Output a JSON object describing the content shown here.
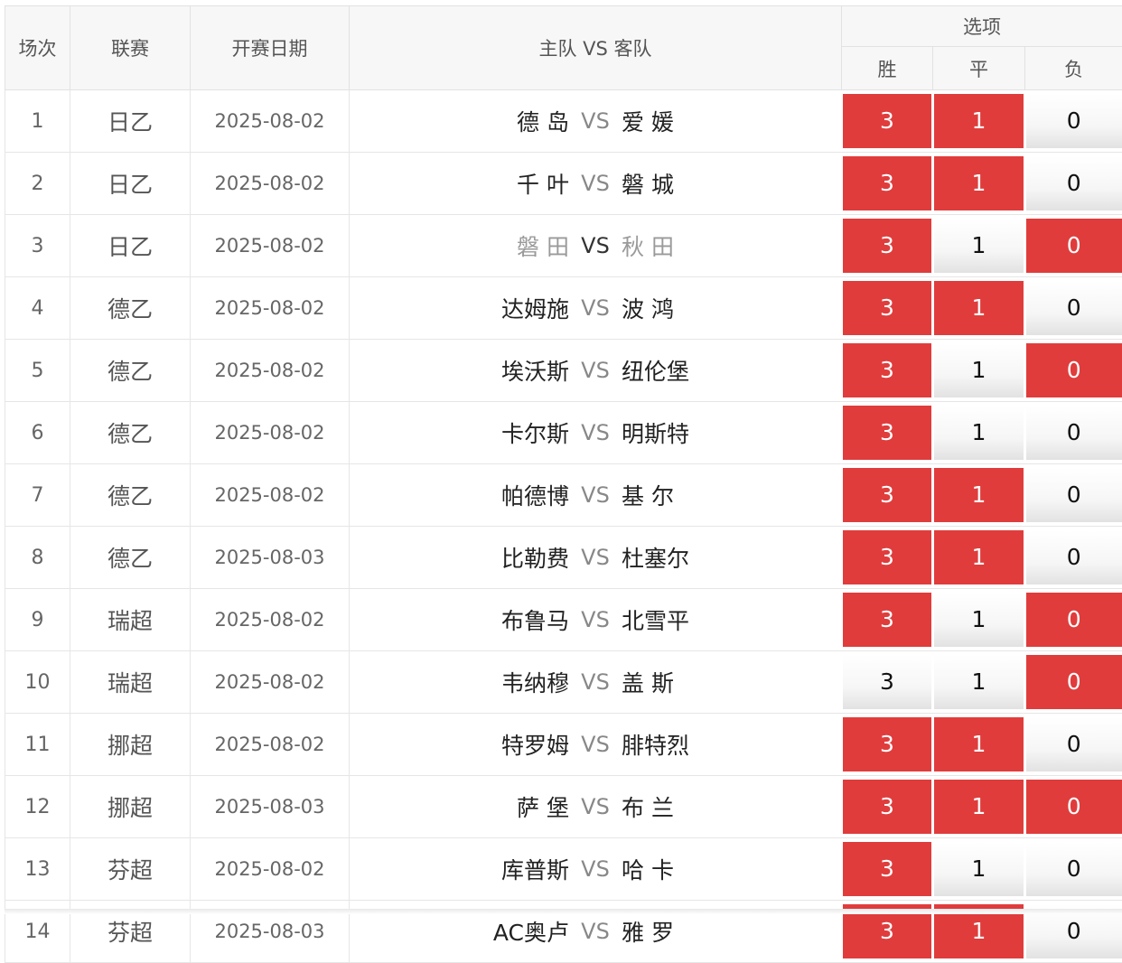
{
  "headers": {
    "no": "场次",
    "league": "联赛",
    "date": "开赛日期",
    "match": "主队 VS 客队",
    "options": "选项",
    "win": "胜",
    "draw": "平",
    "lose": "负"
  },
  "colors": {
    "selected": "#e03c3c",
    "unselected": "#f4f4f4"
  },
  "rows": [
    {
      "no": "1",
      "league": "日乙",
      "date": "2025-08-02",
      "home": "德 岛",
      "vs": "VS",
      "away": "爱 媛",
      "win": "3",
      "draw": "1",
      "lose": "0",
      "sel": [
        true,
        true,
        false
      ],
      "dim": false
    },
    {
      "no": "2",
      "league": "日乙",
      "date": "2025-08-02",
      "home": "千 叶",
      "vs": "VS",
      "away": "磐 城",
      "win": "3",
      "draw": "1",
      "lose": "0",
      "sel": [
        true,
        true,
        false
      ],
      "dim": false
    },
    {
      "no": "3",
      "league": "日乙",
      "date": "2025-08-02",
      "home": "磐 田",
      "vs": "VS",
      "away": "秋 田",
      "win": "3",
      "draw": "1",
      "lose": "0",
      "sel": [
        true,
        false,
        true
      ],
      "dim": true
    },
    {
      "no": "4",
      "league": "德乙",
      "date": "2025-08-02",
      "home": "达姆施",
      "vs": "VS",
      "away": "波 鸿",
      "win": "3",
      "draw": "1",
      "lose": "0",
      "sel": [
        true,
        true,
        false
      ],
      "dim": false
    },
    {
      "no": "5",
      "league": "德乙",
      "date": "2025-08-02",
      "home": "埃沃斯",
      "vs": "VS",
      "away": "纽伦堡",
      "win": "3",
      "draw": "1",
      "lose": "0",
      "sel": [
        true,
        false,
        true
      ],
      "dim": false
    },
    {
      "no": "6",
      "league": "德乙",
      "date": "2025-08-02",
      "home": "卡尔斯",
      "vs": "VS",
      "away": "明斯特",
      "win": "3",
      "draw": "1",
      "lose": "0",
      "sel": [
        true,
        false,
        false
      ],
      "dim": false
    },
    {
      "no": "7",
      "league": "德乙",
      "date": "2025-08-02",
      "home": "帕德博",
      "vs": "VS",
      "away": "基 尔",
      "win": "3",
      "draw": "1",
      "lose": "0",
      "sel": [
        true,
        true,
        false
      ],
      "dim": false
    },
    {
      "no": "8",
      "league": "德乙",
      "date": "2025-08-03",
      "home": "比勒费",
      "vs": "VS",
      "away": "杜塞尔",
      "win": "3",
      "draw": "1",
      "lose": "0",
      "sel": [
        true,
        true,
        false
      ],
      "dim": false
    },
    {
      "no": "9",
      "league": "瑞超",
      "date": "2025-08-02",
      "home": "布鲁马",
      "vs": "VS",
      "away": "北雪平",
      "win": "3",
      "draw": "1",
      "lose": "0",
      "sel": [
        true,
        false,
        true
      ],
      "dim": false
    },
    {
      "no": "10",
      "league": "瑞超",
      "date": "2025-08-02",
      "home": "韦纳穆",
      "vs": "VS",
      "away": "盖 斯",
      "win": "3",
      "draw": "1",
      "lose": "0",
      "sel": [
        false,
        false,
        true
      ],
      "dim": false
    },
    {
      "no": "11",
      "league": "挪超",
      "date": "2025-08-02",
      "home": "特罗姆",
      "vs": "VS",
      "away": "腓特烈",
      "win": "3",
      "draw": "1",
      "lose": "0",
      "sel": [
        true,
        true,
        false
      ],
      "dim": false
    },
    {
      "no": "12",
      "league": "挪超",
      "date": "2025-08-03",
      "home": "萨 堡",
      "vs": "VS",
      "away": "布 兰",
      "win": "3",
      "draw": "1",
      "lose": "0",
      "sel": [
        true,
        true,
        true
      ],
      "dim": false
    },
    {
      "no": "13",
      "league": "芬超",
      "date": "2025-08-02",
      "home": "库普斯",
      "vs": "VS",
      "away": "哈 卡",
      "win": "3",
      "draw": "1",
      "lose": "0",
      "sel": [
        true,
        false,
        false
      ],
      "dim": false
    },
    {
      "no": "14",
      "league": "芬超",
      "date": "2025-08-03",
      "home": "AC奥卢",
      "vs": "VS",
      "away": "雅 罗",
      "win": "3",
      "draw": "1",
      "lose": "0",
      "sel": [
        true,
        true,
        false
      ],
      "dim": false
    }
  ]
}
